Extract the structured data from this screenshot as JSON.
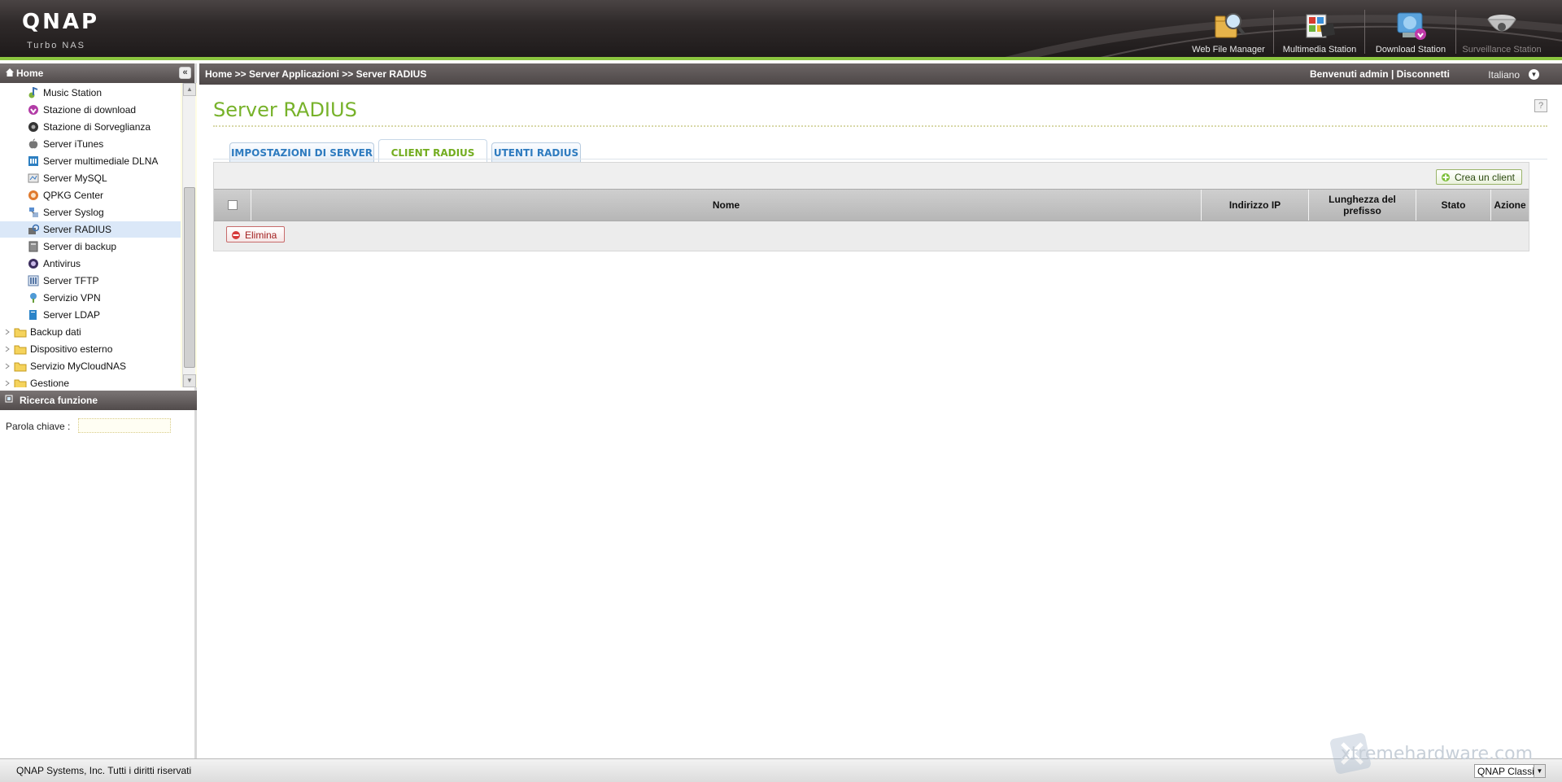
{
  "header": {
    "logo": "QNAP",
    "logo_sub": "Turbo NAS",
    "apps": [
      {
        "label": "Web File Manager",
        "icon": "web-file-manager-icon"
      },
      {
        "label": "Multimedia Station",
        "icon": "multimedia-station-icon"
      },
      {
        "label": "Download Station",
        "icon": "download-station-icon"
      },
      {
        "label": "Surveillance Station",
        "icon": "surveillance-station-icon"
      }
    ],
    "accent_color": "#8bc53f"
  },
  "sidebar": {
    "title": "Home",
    "collapse_label": "«",
    "items": [
      {
        "label": "Music Station",
        "icon": "music-note-icon"
      },
      {
        "label": "Stazione di download",
        "icon": "download-icon"
      },
      {
        "label": "Stazione di Sorveglianza",
        "icon": "camera-icon"
      },
      {
        "label": "Server iTunes",
        "icon": "apple-icon"
      },
      {
        "label": "Server multimediale DLNA",
        "icon": "dlna-icon"
      },
      {
        "label": "Server MySQL",
        "icon": "database-icon"
      },
      {
        "label": "QPKG Center",
        "icon": "qpkg-icon"
      },
      {
        "label": "Server Syslog",
        "icon": "syslog-icon"
      },
      {
        "label": "Server RADIUS",
        "icon": "radius-icon",
        "selected": true
      },
      {
        "label": "Server di backup",
        "icon": "backup-server-icon"
      },
      {
        "label": "Antivirus",
        "icon": "antivirus-icon"
      },
      {
        "label": "Server TFTP",
        "icon": "tftp-icon"
      },
      {
        "label": "Servizio VPN",
        "icon": "vpn-icon"
      },
      {
        "label": "Server LDAP",
        "icon": "ldap-icon"
      }
    ],
    "folders": [
      {
        "label": "Backup dati"
      },
      {
        "label": "Dispositivo esterno"
      },
      {
        "label": "Servizio MyCloudNAS"
      },
      {
        "label": "Gestione"
      }
    ],
    "search": {
      "title": "Ricerca funzione",
      "label": "Parola chiave :",
      "value": ""
    }
  },
  "main": {
    "breadcrumb": "Home >> Server Applicazioni >> Server RADIUS",
    "welcome": "Benvenuti admin | Disconnetti",
    "language": "Italiano",
    "title": "Server RADIUS",
    "tabs": [
      {
        "label": "IMPOSTAZIONI DI SERVER",
        "active": false
      },
      {
        "label": "CLIENT RADIUS",
        "active": true
      },
      {
        "label": "UTENTI RADIUS",
        "active": false
      }
    ],
    "create_button": "Crea un client",
    "columns": [
      "Nome",
      "Indirizzo IP",
      "Lunghezza del prefisso",
      "Stato",
      "Azione"
    ],
    "rows": [],
    "delete_button": "Elimina"
  },
  "footer": {
    "copyright": "QNAP Systems, Inc. Tutti i diritti riservati",
    "theme": "QNAP Classic",
    "watermark": "xtremehardware.com"
  }
}
